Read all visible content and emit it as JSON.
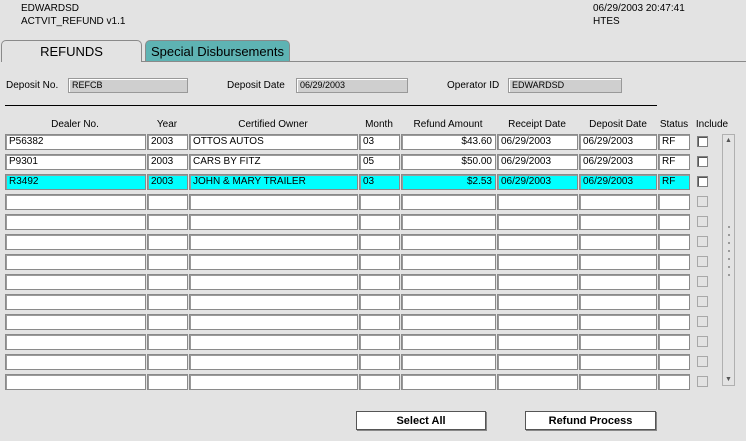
{
  "header": {
    "user": "EDWARDSD",
    "module": "ACTVIT_REFUND v1.1",
    "datetime": "06/29/2003 20:47:41",
    "system": "HTES"
  },
  "tabs": [
    {
      "label": "REFUNDS",
      "active": true
    },
    {
      "label": "Special Disbursements",
      "active": false
    }
  ],
  "form": {
    "deposit_no_label": "Deposit No.",
    "deposit_no": "REFCB",
    "deposit_date_label": "Deposit Date",
    "deposit_date": "06/29/2003",
    "operator_label": "Operator ID",
    "operator": "EDWARDSD"
  },
  "table": {
    "columns": [
      "Dealer No.",
      "Year",
      "Certified Owner",
      "Month",
      "Refund Amount",
      "Receipt Date",
      "Deposit Date",
      "Status",
      "Include"
    ],
    "rows": [
      {
        "dealer": "P56382",
        "year": "2003",
        "owner": "OTTOS AUTOS",
        "month": "03",
        "amount": "$43.60",
        "receipt": "06/29/2003",
        "deposit": "06/29/2003",
        "status": "RF"
      },
      {
        "dealer": "P9301",
        "year": "2003",
        "owner": "CARS BY FITZ",
        "month": "05",
        "amount": "$50.00",
        "receipt": "06/29/2003",
        "deposit": "06/29/2003",
        "status": "RF"
      },
      {
        "dealer": "R3492",
        "year": "2003",
        "owner": "JOHN & MARY TRAILER",
        "month": "03",
        "amount": "$2.53",
        "receipt": "06/29/2003",
        "deposit": "06/29/2003",
        "status": "RF"
      }
    ],
    "selected_row": 2,
    "total_rows": 13
  },
  "buttons": {
    "select_all": "Select All",
    "refund_process": "Refund Process"
  },
  "colors": {
    "background": "#e3e3e3",
    "selected_row": "#00ffff",
    "inactive_tab": "#5eb3b3"
  }
}
